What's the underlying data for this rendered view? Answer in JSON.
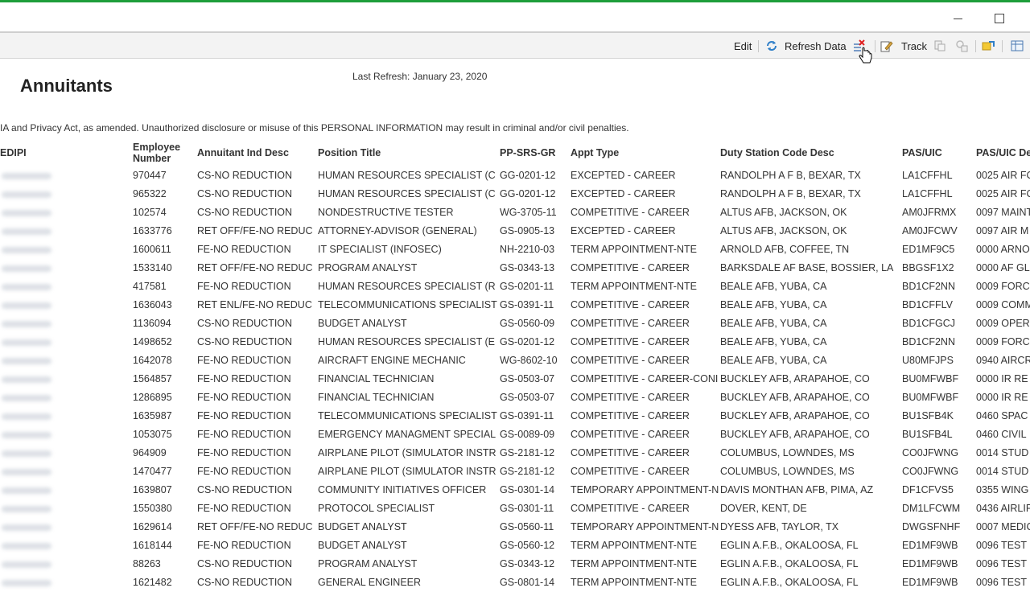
{
  "toolbar": {
    "edit_label": "Edit",
    "refresh_label": "Refresh Data",
    "track_label": "Track"
  },
  "report": {
    "title": "Annuitants",
    "last_refresh": "Last Refresh: January 23, 2020",
    "disclaimer": "IA and Privacy Act, as amended. Unauthorized disclosure or misuse of this PERSONAL INFORMATION may result in criminal and/or civil penalties."
  },
  "table": {
    "headers": {
      "edipi": "EDIPI",
      "emp_line1": "Employee",
      "emp_line2": "Number",
      "ind": "Annuitant Ind Desc",
      "pos": "Position Title",
      "grade": "PP-SRS-GR",
      "appt": "Appt Type",
      "duty": "Duty Station Code Desc",
      "pas": "PAS/UIC",
      "pasd": "PAS/UIC De"
    },
    "rows": [
      {
        "emp": "970447",
        "ind": "CS-NO REDUCTION",
        "pos": "HUMAN RESOURCES SPECIALIST (C",
        "grade": "GG-0201-12",
        "appt": "EXCEPTED - CAREER",
        "duty": "RANDOLPH A F B, BEXAR, TX",
        "pas": "LA1CFFHL",
        "pasd": "0025 AIR FO"
      },
      {
        "emp": "965322",
        "ind": "CS-NO REDUCTION",
        "pos": "HUMAN RESOURCES SPECIALIST (C",
        "grade": "GG-0201-12",
        "appt": "EXCEPTED - CAREER",
        "duty": "RANDOLPH A F B, BEXAR, TX",
        "pas": "LA1CFFHL",
        "pasd": "0025 AIR FO"
      },
      {
        "emp": "102574",
        "ind": "CS-NO REDUCTION",
        "pos": "NONDESTRUCTIVE TESTER",
        "grade": "WG-3705-11",
        "appt": "COMPETITIVE - CAREER",
        "duty": "ALTUS AFB, JACKSON, OK",
        "pas": "AM0JFRMX",
        "pasd": "0097 MAINT"
      },
      {
        "emp": "1633776",
        "ind": "RET OFF/FE-NO REDUC",
        "pos": "ATTORNEY-ADVISOR (GENERAL)",
        "grade": "GS-0905-13",
        "appt": "EXCEPTED - CAREER",
        "duty": "ALTUS AFB, JACKSON, OK",
        "pas": "AM0JFCWV",
        "pasd": "0097 AIR M"
      },
      {
        "emp": "1600611",
        "ind": "FE-NO REDUCTION",
        "pos": "IT SPECIALIST (INFOSEC)",
        "grade": "NH-2210-03",
        "appt": "TERM APPOINTMENT-NTE",
        "duty": "ARNOLD AFB, COFFEE, TN",
        "pas": "ED1MF9C5",
        "pasd": "0000 ARNO"
      },
      {
        "emp": "1533140",
        "ind": "RET OFF/FE-NO REDUC",
        "pos": "PROGRAM ANALYST",
        "grade": "GS-0343-13",
        "appt": "COMPETITIVE - CAREER",
        "duty": "BARKSDALE AF BASE, BOSSIER, LA",
        "pas": "BBGSF1X2",
        "pasd": "0000 AF GL"
      },
      {
        "emp": "417581",
        "ind": "FE-NO REDUCTION",
        "pos": "HUMAN RESOURCES SPECIALIST (R",
        "grade": "GS-0201-11",
        "appt": "TERM APPOINTMENT-NTE",
        "duty": "BEALE AFB, YUBA, CA",
        "pas": "BD1CF2NN",
        "pasd": "0009 FORC"
      },
      {
        "emp": "1636043",
        "ind": "RET ENL/FE-NO REDUC",
        "pos": "TELECOMMUNICATIONS SPECIALIST",
        "grade": "GS-0391-11",
        "appt": "COMPETITIVE - CAREER",
        "duty": "BEALE AFB, YUBA, CA",
        "pas": "BD1CFFLV",
        "pasd": "0009 COMM"
      },
      {
        "emp": "1136094",
        "ind": "CS-NO REDUCTION",
        "pos": "BUDGET ANALYST",
        "grade": "GS-0560-09",
        "appt": "COMPETITIVE - CAREER",
        "duty": "BEALE AFB, YUBA, CA",
        "pas": "BD1CFGCJ",
        "pasd": "0009 OPER"
      },
      {
        "emp": "1498652",
        "ind": "CS-NO REDUCTION",
        "pos": "HUMAN RESOURCES SPECIALIST (E",
        "grade": "GS-0201-12",
        "appt": "COMPETITIVE - CAREER",
        "duty": "BEALE AFB, YUBA, CA",
        "pas": "BD1CF2NN",
        "pasd": "0009 FORC"
      },
      {
        "emp": "1642078",
        "ind": "FE-NO REDUCTION",
        "pos": "AIRCRAFT ENGINE MECHANIC",
        "grade": "WG-8602-10",
        "appt": "COMPETITIVE - CAREER",
        "duty": "BEALE AFB, YUBA, CA",
        "pas": "U80MFJPS",
        "pasd": "0940 AIRCR"
      },
      {
        "emp": "1564857",
        "ind": "FE-NO REDUCTION",
        "pos": "FINANCIAL TECHNICIAN",
        "grade": "GS-0503-07",
        "appt": "COMPETITIVE - CAREER-CONI",
        "duty": "BUCKLEY AFB, ARAPAHOE, CO",
        "pas": "BU0MFWBF",
        "pasd": "0000 IR RE"
      },
      {
        "emp": "1286895",
        "ind": "FE-NO REDUCTION",
        "pos": "FINANCIAL TECHNICIAN",
        "grade": "GS-0503-07",
        "appt": "COMPETITIVE - CAREER",
        "duty": "BUCKLEY AFB, ARAPAHOE, CO",
        "pas": "BU0MFWBF",
        "pasd": "0000 IR RE"
      },
      {
        "emp": "1635987",
        "ind": "FE-NO REDUCTION",
        "pos": "TELECOMMUNICATIONS SPECIALIST",
        "grade": "GS-0391-11",
        "appt": "COMPETITIVE - CAREER",
        "duty": "BUCKLEY AFB, ARAPAHOE, CO",
        "pas": "BU1SFB4K",
        "pasd": "0460 SPAC"
      },
      {
        "emp": "1053075",
        "ind": "FE-NO REDUCTION",
        "pos": "EMERGENCY MANAGMENT SPECIAL",
        "grade": "GS-0089-09",
        "appt": "COMPETITIVE - CAREER",
        "duty": "BUCKLEY AFB, ARAPAHOE, CO",
        "pas": "BU1SFB4L",
        "pasd": "0460 CIVIL"
      },
      {
        "emp": "964909",
        "ind": "FE-NO REDUCTION",
        "pos": "AIRPLANE PILOT (SIMULATOR INSTR",
        "grade": "GS-2181-12",
        "appt": "COMPETITIVE - CAREER",
        "duty": "COLUMBUS, LOWNDES, MS",
        "pas": "CO0JFWNG",
        "pasd": "0014 STUD"
      },
      {
        "emp": "1470477",
        "ind": "FE-NO REDUCTION",
        "pos": "AIRPLANE PILOT (SIMULATOR INSTR",
        "grade": "GS-2181-12",
        "appt": "COMPETITIVE - CAREER",
        "duty": "COLUMBUS, LOWNDES, MS",
        "pas": "CO0JFWNG",
        "pasd": "0014 STUD"
      },
      {
        "emp": "1639807",
        "ind": "CS-NO REDUCTION",
        "pos": "COMMUNITY INITIATIVES OFFICER",
        "grade": "GS-0301-14",
        "appt": "TEMPORARY APPOINTMENT-N",
        "duty": "DAVIS MONTHAN AFB, PIMA, AZ",
        "pas": "DF1CFVS5",
        "pasd": "0355 WING"
      },
      {
        "emp": "1550380",
        "ind": "FE-NO REDUCTION",
        "pos": "PROTOCOL SPECIALIST",
        "grade": "GS-0301-11",
        "appt": "COMPETITIVE - CAREER",
        "duty": "DOVER, KENT, DE",
        "pas": "DM1LFCWM",
        "pasd": "0436 AIRLIF"
      },
      {
        "emp": "1629614",
        "ind": "RET OFF/FE-NO REDUC",
        "pos": "BUDGET ANALYST",
        "grade": "GS-0560-11",
        "appt": "TEMPORARY APPOINTMENT-N",
        "duty": "DYESS AFB, TAYLOR, TX",
        "pas": "DWGSFNHF",
        "pasd": "0007 MEDIC"
      },
      {
        "emp": "1618144",
        "ind": "FE-NO REDUCTION",
        "pos": "BUDGET ANALYST",
        "grade": "GS-0560-12",
        "appt": "TERM APPOINTMENT-NTE",
        "duty": "EGLIN A.F.B., OKALOOSA, FL",
        "pas": "ED1MF9WB",
        "pasd": "0096 TEST"
      },
      {
        "emp": "88263",
        "ind": "CS-NO REDUCTION",
        "pos": "PROGRAM ANALYST",
        "grade": "GS-0343-12",
        "appt": "TERM APPOINTMENT-NTE",
        "duty": "EGLIN A.F.B., OKALOOSA, FL",
        "pas": "ED1MF9WB",
        "pasd": "0096 TEST"
      },
      {
        "emp": "1621482",
        "ind": "CS-NO REDUCTION",
        "pos": "GENERAL ENGINEER",
        "grade": "GS-0801-14",
        "appt": "TERM APPOINTMENT-NTE",
        "duty": "EGLIN A.F.B., OKALOOSA, FL",
        "pas": "ED1MF9WB",
        "pasd": "0096 TEST"
      }
    ]
  }
}
